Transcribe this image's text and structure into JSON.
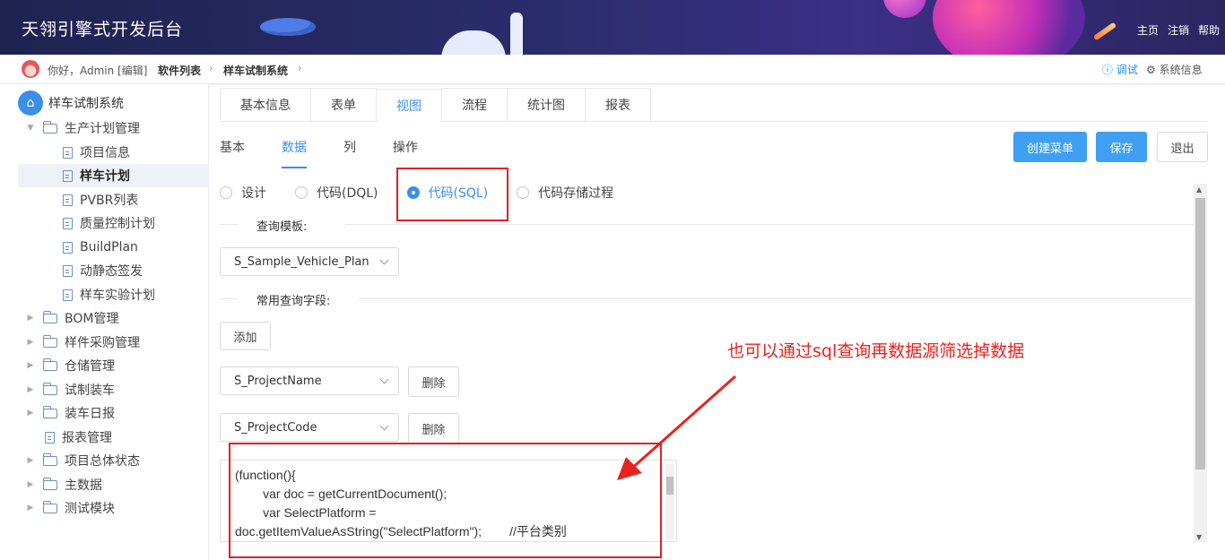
{
  "header": {
    "title": "天翎引擎式开发后台",
    "links": [
      "主页",
      "注销",
      "帮助"
    ]
  },
  "crumbbar": {
    "greeting": "你好，Admin [编辑]",
    "crumbs": [
      "软件列表",
      "样车试制系统"
    ],
    "debug": "ⓘ 调试",
    "sysinfo": "⚙ 系统信息"
  },
  "sidebar": {
    "root": "样车试制系统",
    "items": [
      {
        "label": "生产计划管理",
        "type": "folder",
        "expanded": true
      },
      {
        "label": "项目信息",
        "type": "doc"
      },
      {
        "label": "样车计划",
        "type": "doc",
        "active": true
      },
      {
        "label": "PVBR列表",
        "type": "doc"
      },
      {
        "label": "质量控制计划",
        "type": "doc"
      },
      {
        "label": "BuildPlan",
        "type": "doc"
      },
      {
        "label": "动静态签发",
        "type": "doc"
      },
      {
        "label": "样车实验计划",
        "type": "doc"
      },
      {
        "label": "BOM管理",
        "type": "folder"
      },
      {
        "label": "样件采购管理",
        "type": "folder"
      },
      {
        "label": "仓储管理",
        "type": "folder"
      },
      {
        "label": "试制装车",
        "type": "folder"
      },
      {
        "label": "装车日报",
        "type": "folder"
      },
      {
        "label": "报表管理",
        "type": "doc"
      },
      {
        "label": "项目总体状态",
        "type": "folder"
      },
      {
        "label": "主数据",
        "type": "folder"
      },
      {
        "label": "测试模块",
        "type": "folder"
      }
    ]
  },
  "tabs": [
    "基本信息",
    "表单",
    "视图",
    "流程",
    "统计图",
    "报表"
  ],
  "active_tab": "视图",
  "subtabs": [
    "基本",
    "数据",
    "列",
    "操作"
  ],
  "active_subtab": "数据",
  "buttons": {
    "create_menu": "创建菜单",
    "save": "保存",
    "exit": "退出"
  },
  "radios": [
    "设计",
    "代码(DQL)",
    "代码(SQL)",
    "代码存储过程"
  ],
  "active_radio": "代码(SQL)",
  "query_template": {
    "label": "查询模板:",
    "value": "S_Sample_Vehicle_Plan"
  },
  "common_fields": {
    "label": "常用查询字段:",
    "add_label": "添加",
    "delete_label": "删除",
    "fields": [
      "S_ProjectName",
      "S_ProjectCode"
    ]
  },
  "code_lines": [
    "(function(){",
    "        var doc = getCurrentDocument();",
    "        var SelectPlatform =",
    "doc.getItemValueAsString(\"SelectPlatform\");        //平台类别"
  ],
  "annotation": "也可以通过sql查询再数据源筛选掉数据",
  "colors": {
    "accent": "#3b8fe8",
    "annotation": "#e8231f",
    "header_bg": "#2a2d6b"
  }
}
